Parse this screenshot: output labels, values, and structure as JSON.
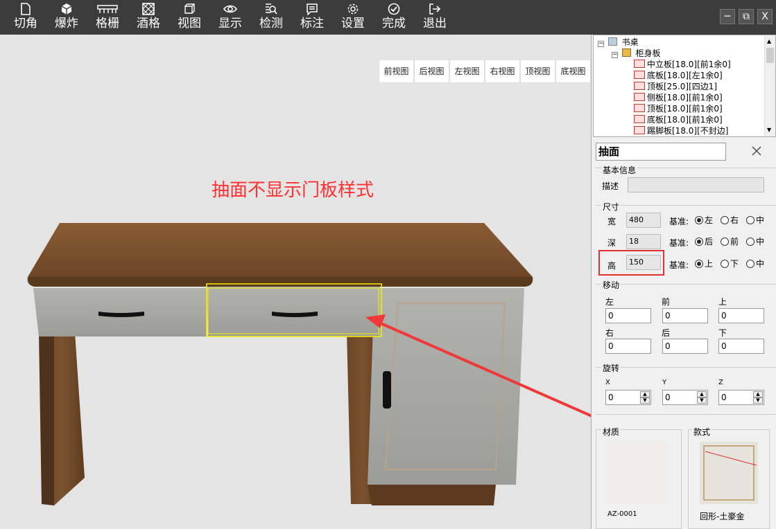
{
  "toolbar": {
    "items": [
      {
        "label": "切角",
        "icon": "page-icon"
      },
      {
        "label": "爆炸",
        "icon": "cube-icon"
      },
      {
        "label": "格栅",
        "icon": "grille-icon"
      },
      {
        "label": "酒格",
        "icon": "wine-rack-icon"
      },
      {
        "label": "视图",
        "icon": "view-cube-icon"
      },
      {
        "label": "显示",
        "icon": "eye-icon"
      },
      {
        "label": "检测",
        "icon": "inspect-icon"
      },
      {
        "label": "标注",
        "icon": "annotation-icon"
      },
      {
        "label": "设置",
        "icon": "gear-icon"
      },
      {
        "label": "完成",
        "icon": "check-circle-icon"
      },
      {
        "label": "退出",
        "icon": "exit-icon"
      }
    ],
    "win_min": "─",
    "win_restore": "⧉",
    "win_close": "X"
  },
  "viewport": {
    "view_tabs": [
      "前视图",
      "后视图",
      "左视图",
      "右视图",
      "顶视图",
      "底视图"
    ],
    "annotation": "抽面不显示门板样式"
  },
  "tree": {
    "root": "书桌",
    "group": "柜身板",
    "items": [
      "中立板[18.0][前1余0]",
      "底板[18.0][左1余0]",
      "顶板[25.0][四边1]",
      "侧板[18.0][前1余0]",
      "顶板[18.0][前1余0]",
      "底板[18.0][前1余0]",
      "踢脚板[18.0][不封边]"
    ]
  },
  "props": {
    "name": "抽面",
    "basic_title": "基本信息",
    "desc_label": "描述",
    "desc_value": "",
    "size_title": "尺寸",
    "width_label": "宽",
    "width_value": "480",
    "depth_label": "深",
    "depth_value": "18",
    "height_label": "高",
    "height_value": "150",
    "base_label": "基准:",
    "width_opts": [
      "左",
      "右",
      "中"
    ],
    "depth_opts": [
      "后",
      "前",
      "中"
    ],
    "height_opts": [
      "上",
      "下",
      "中"
    ],
    "move_title": "移动",
    "move_left": "左",
    "move_front": "前",
    "move_up": "上",
    "move_right": "右",
    "move_back": "后",
    "move_down": "下",
    "move_values": [
      "0",
      "0",
      "0",
      "0",
      "0",
      "0"
    ],
    "rotate_title": "旋转",
    "rot_x": "X",
    "rot_y": "Y",
    "rot_z": "Z",
    "rot_values": [
      "0",
      "0",
      "0"
    ],
    "material_title": "材质",
    "material_code": "AZ-0001",
    "style_title": "款式",
    "style_name": "回形-土豪金"
  },
  "colors": {
    "toolbar_bg": "#3c3c3c",
    "highlight_red": "#e03030",
    "annotation_red": "#ff3030",
    "selection_yellow": "#f5f000"
  }
}
